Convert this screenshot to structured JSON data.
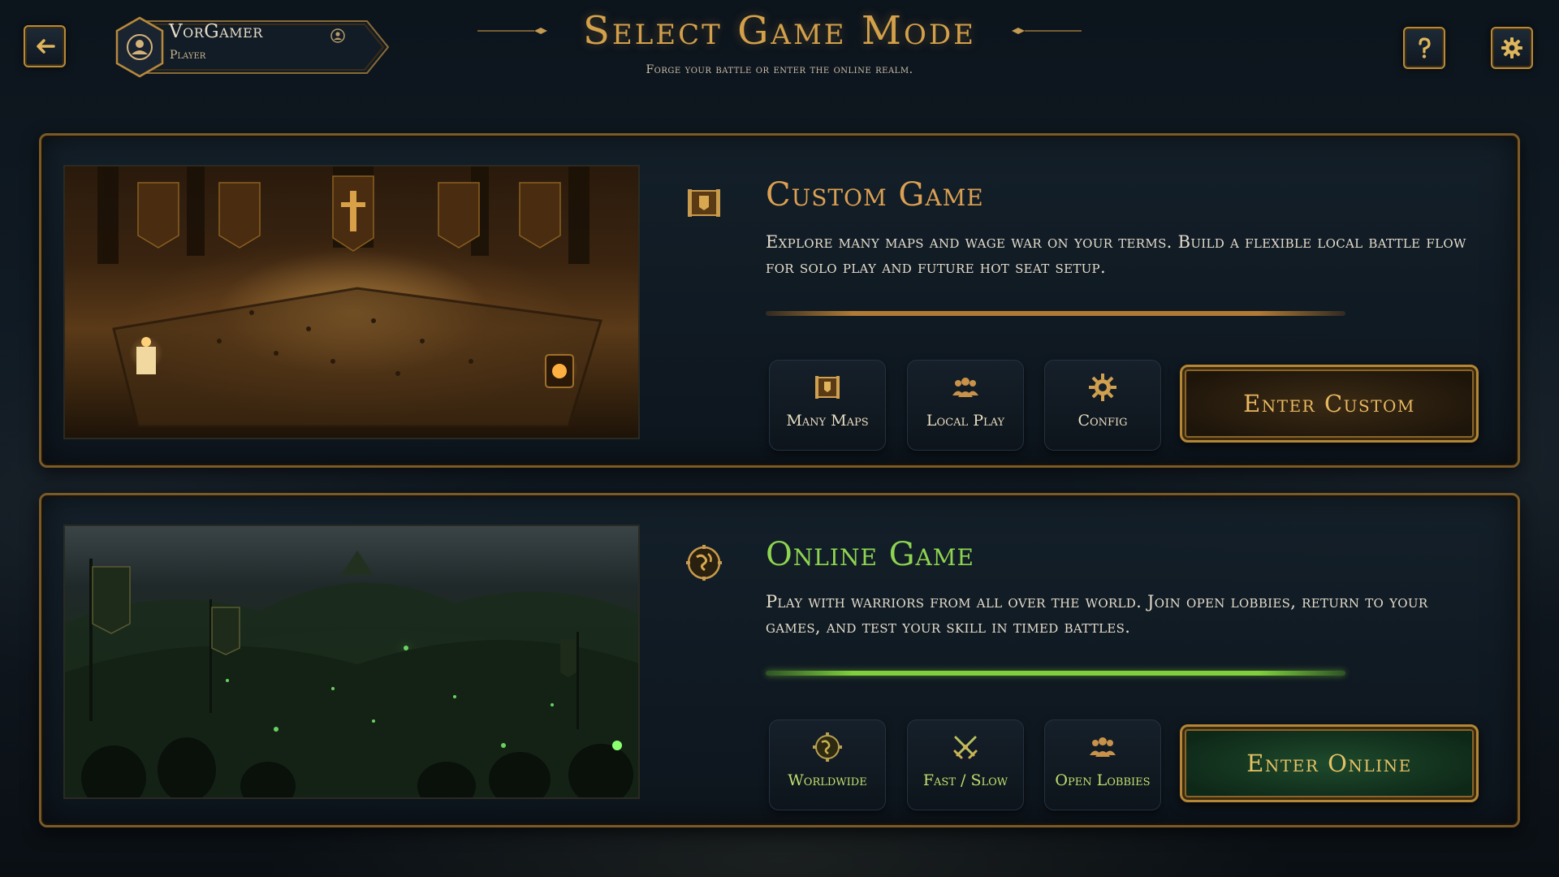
{
  "header": {
    "title": "Select Game Mode",
    "subtitle": "Forge your battle or enter the online realm.",
    "back_icon": "arrow-left-icon",
    "help_icon": "question-mark-icon",
    "settings_icon": "gear-icon"
  },
  "profile": {
    "name": "VorGamer",
    "role": "Player",
    "avatar_icon": "user-avatar-icon",
    "badge_icon": "user-badge-icon"
  },
  "modes": [
    {
      "id": "custom",
      "title": "Custom Game",
      "description": "Explore many maps and wage war on your terms. Build a flexible local battle flow for solo play and future hot seat setup.",
      "icon": "map-banner-icon",
      "accent": "#dca052",
      "features": [
        {
          "label": "Many Maps",
          "icon": "map-icon"
        },
        {
          "label": "Local Play",
          "icon": "group-icon"
        },
        {
          "label": "Config",
          "icon": "gear-icon"
        }
      ],
      "button_label": "Enter Custom"
    },
    {
      "id": "online",
      "title": "Online Game",
      "description": "Play with warriors from all over the world. Join open lobbies, return to your games, and test your skill in timed battles.",
      "icon": "globe-emblem-icon",
      "accent": "#8ed450",
      "features": [
        {
          "label": "Worldwide",
          "icon": "globe-icon"
        },
        {
          "label": "Fast / Slow",
          "icon": "crossed-swords-icon"
        },
        {
          "label": "Open Lobbies",
          "icon": "group-icon"
        }
      ],
      "button_label": "Enter Online"
    }
  ]
}
